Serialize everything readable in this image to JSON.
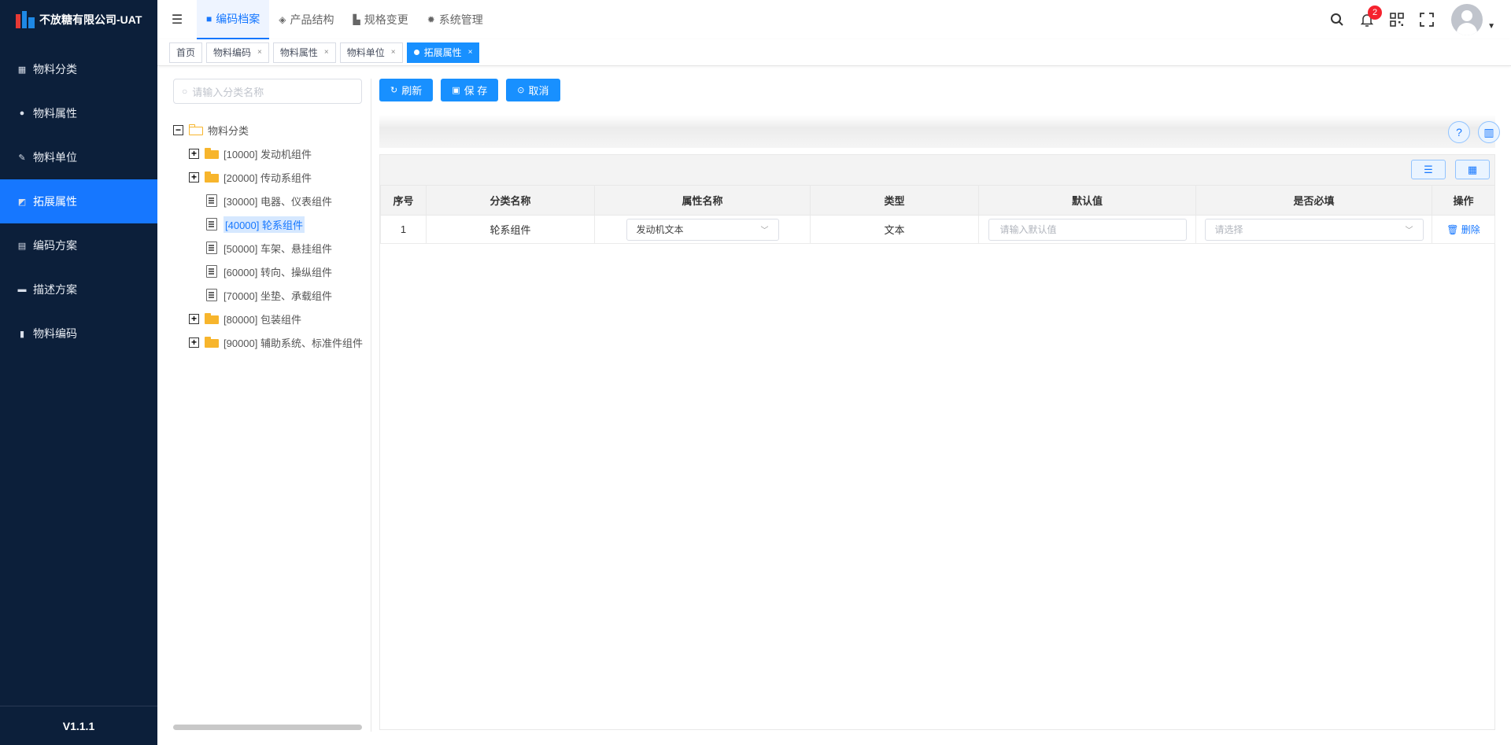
{
  "app": {
    "title": "不放糖有限公司-UAT",
    "version": "V1.1.1"
  },
  "sidebar": {
    "items": [
      {
        "label": "物料分类",
        "icon": "grid-icon"
      },
      {
        "label": "物料属性",
        "icon": "info-icon"
      },
      {
        "label": "物料单位",
        "icon": "ruler-icon"
      },
      {
        "label": "拓展属性",
        "icon": "extend-icon",
        "active": true
      },
      {
        "label": "编码方案",
        "icon": "copy-icon"
      },
      {
        "label": "描述方案",
        "icon": "monitor-icon"
      },
      {
        "label": "物料编码",
        "icon": "document-icon"
      }
    ]
  },
  "header": {
    "tabs": [
      {
        "label": "编码档案",
        "icon": "folder-icon",
        "active": true
      },
      {
        "label": "产品结构",
        "icon": "layers-icon"
      },
      {
        "label": "规格变更",
        "icon": "chart-icon"
      },
      {
        "label": "系统管理",
        "icon": "gear-icon"
      }
    ],
    "notification_count": "2"
  },
  "tagbar": {
    "tags": [
      {
        "label": "首页",
        "closable": false
      },
      {
        "label": "物料编码",
        "closable": true
      },
      {
        "label": "物料属性",
        "closable": true
      },
      {
        "label": "物料单位",
        "closable": true
      },
      {
        "label": "拓展属性",
        "closable": true,
        "active": true
      }
    ],
    "close_glyph": "×"
  },
  "tree": {
    "search_placeholder": "请输入分类名称",
    "root": "物料分类",
    "nodes": [
      {
        "label": "[10000] 发动机组件",
        "type": "folder"
      },
      {
        "label": "[20000] 传动系组件",
        "type": "folder"
      },
      {
        "label": "[30000] 电器、仪表组件",
        "type": "doc"
      },
      {
        "label": "[40000] 轮系组件",
        "type": "doc",
        "selected": true
      },
      {
        "label": "[50000] 车架、悬挂组件",
        "type": "doc"
      },
      {
        "label": "[60000] 转向、操纵组件",
        "type": "doc"
      },
      {
        "label": "[70000] 坐垫、承载组件",
        "type": "doc"
      },
      {
        "label": "[80000] 包装组件",
        "type": "folder"
      },
      {
        "label": "[90000] 辅助系统、标准件组件",
        "type": "folder"
      }
    ]
  },
  "toolbar": {
    "refresh_label": "刷新",
    "save_label": "保 存",
    "cancel_label": "取消"
  },
  "table": {
    "headers": [
      "序号",
      "分类名称",
      "属性名称",
      "类型",
      "默认值",
      "是否必填",
      "操作"
    ],
    "rows": [
      {
        "index": "1",
        "category": "轮系组件",
        "attribute": "发动机文本",
        "type": "文本",
        "default_placeholder": "请输入默认值",
        "required_placeholder": "请选择",
        "action": "删除"
      }
    ]
  },
  "colors": {
    "primary": "#1890ff",
    "sidebar_bg": "#0c1f3a",
    "folder": "#f7b52c",
    "badge": "#f5222d"
  }
}
